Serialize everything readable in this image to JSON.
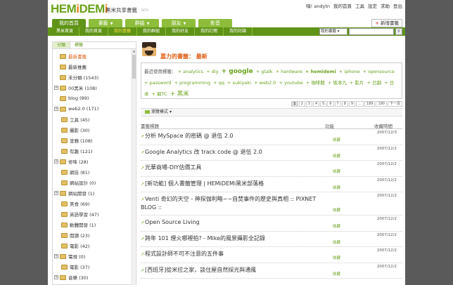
{
  "logo": {
    "part1": "HEM",
    "part2": "i",
    "part3": "DEM",
    "part4": "i",
    "subtitle": "黑米共享書籤",
    "beta": "BETA"
  },
  "toplinks": [
    "嗨! andytn",
    "我的首頁",
    "工具",
    "設定",
    "求助",
    "登出"
  ],
  "mainnav": {
    "tabs": [
      "我的首頁",
      "書籤",
      "群組",
      "朋友",
      "影音"
    ],
    "new_bookmark": "新增書籤"
  },
  "subnav": {
    "items": [
      "黑米首頁",
      "我的首頁",
      "我的書籤",
      "我的群組",
      "我的好友",
      "我的訂閱",
      "我的討論"
    ],
    "search_scope": "我的書籤"
  },
  "sidebar": {
    "tabs": [
      "分類",
      "標籤"
    ],
    "tree": [
      {
        "label": "最新書籤",
        "expand": false,
        "indent": 0
      },
      {
        "label": "最新推薦",
        "expand": false,
        "indent": 0
      },
      {
        "label": "未分類 (1543)",
        "expand": false,
        "indent": 0
      },
      {
        "label": "00黑米 (108)",
        "expand": true,
        "indent": 0
      },
      {
        "label": "blog (89)",
        "expand": false,
        "indent": 0
      },
      {
        "label": "web2.0 (171)",
        "expand": true,
        "indent": 0
      },
      {
        "label": "工具 (45)",
        "expand": false,
        "indent": 1
      },
      {
        "label": "攝影 (30)",
        "expand": false,
        "indent": 1
      },
      {
        "label": "塗鴉 (108)",
        "expand": false,
        "indent": 1
      },
      {
        "label": "有趣 (121)",
        "expand": false,
        "indent": 1
      },
      {
        "label": "修味 (28)",
        "expand": true,
        "indent": 0
      },
      {
        "label": "網誌 (81)",
        "expand": false,
        "indent": 1
      },
      {
        "label": "網站設計 (0)",
        "expand": false,
        "indent": 1
      },
      {
        "label": "網站開發 (1)",
        "expand": true,
        "indent": 0
      },
      {
        "label": "美食 (69)",
        "expand": false,
        "indent": 1
      },
      {
        "label": "英語學習 (47)",
        "expand": false,
        "indent": 1
      },
      {
        "label": "軟體開發 (1)",
        "expand": false,
        "indent": 1
      },
      {
        "label": "閱讀 (23)",
        "expand": false,
        "indent": 1
      },
      {
        "label": "電影 (42)",
        "expand": false,
        "indent": 1
      },
      {
        "label": "電視 (0)",
        "expand": true,
        "indent": 0
      },
      {
        "label": "電影 (37)",
        "expand": false,
        "indent": 1
      },
      {
        "label": "音樂 (30)",
        "expand": true,
        "indent": 0
      }
    ]
  },
  "profile": {
    "title": "嘉力的書籤： 最新"
  },
  "tags": {
    "header": "最近使用標籤：",
    "items": [
      {
        "t": "analytics",
        "s": ""
      },
      {
        "t": "diy",
        "s": ""
      },
      {
        "t": "google",
        "s": "big"
      },
      {
        "t": "gtalk",
        "s": ""
      },
      {
        "t": "hardware",
        "s": ""
      },
      {
        "t": "hemidemi",
        "s": "mid"
      },
      {
        "t": "iphone",
        "s": ""
      },
      {
        "t": "opensource",
        "s": ""
      },
      {
        "t": "password",
        "s": ""
      },
      {
        "t": "programming",
        "s": ""
      },
      {
        "t": "qq",
        "s": ""
      },
      {
        "t": "sukiyaki",
        "s": ""
      },
      {
        "t": "web2.0",
        "s": ""
      },
      {
        "t": "youtube",
        "s": ""
      },
      {
        "t": "咖啡聽",
        "s": ""
      },
      {
        "t": "坂本九",
        "s": ""
      },
      {
        "t": "影片",
        "s": ""
      },
      {
        "t": "日劇",
        "s": ""
      },
      {
        "t": "日本",
        "s": ""
      },
      {
        "t": "窮TC",
        "s": ""
      },
      {
        "t": "黑米",
        "s": "lg"
      }
    ]
  },
  "pager": [
    "1",
    "2",
    "3",
    "4",
    "5",
    "6",
    "7",
    "8",
    "9",
    "...",
    "189",
    "190",
    "下一頁"
  ],
  "viewmode": "瀏覽模式",
  "table": {
    "headers": [
      "書籤標題",
      "功能",
      "收藏時間"
    ],
    "rows": [
      {
        "title": "分析 MySpace 的密碼 @ 退伍 2.0",
        "fn": "收藏",
        "date": "2007/12/3"
      },
      {
        "title": "Google Analytics 改 track code @ 退伍 2.0",
        "fn": "收藏",
        "date": "2007/12/2"
      },
      {
        "title": "光華商場-DIY估價工具",
        "fn": "收藏",
        "date": "2007/12/2"
      },
      {
        "title": "[新功能] 個人書籤管理 | HEMiDEMi黑米部落格",
        "fn": "收藏",
        "date": "2007/12/2"
      },
      {
        "title": "Venti 奇幻的天空 - 神探伽利略~~自焚事件的歷史與真相 :: PIXNET BLOG ::",
        "fn": "收藏",
        "date": "2007/12/2"
      },
      {
        "title": "Open Source Living",
        "fn": "收藏",
        "date": "2007/12/2"
      },
      {
        "title": "跨年 101 煙火哪裡拍? - Mike的風景攝影全記錄",
        "fn": "收藏",
        "date": "2007/12/2"
      },
      {
        "title": "程式設計師不可不注意的五件事",
        "fn": "收藏",
        "date": "2007/12/2"
      },
      {
        "title": "[西班牙]從米拉之家，談住屋自然採光與通風",
        "fn": "收藏",
        "date": "2007/12/2"
      }
    ]
  }
}
